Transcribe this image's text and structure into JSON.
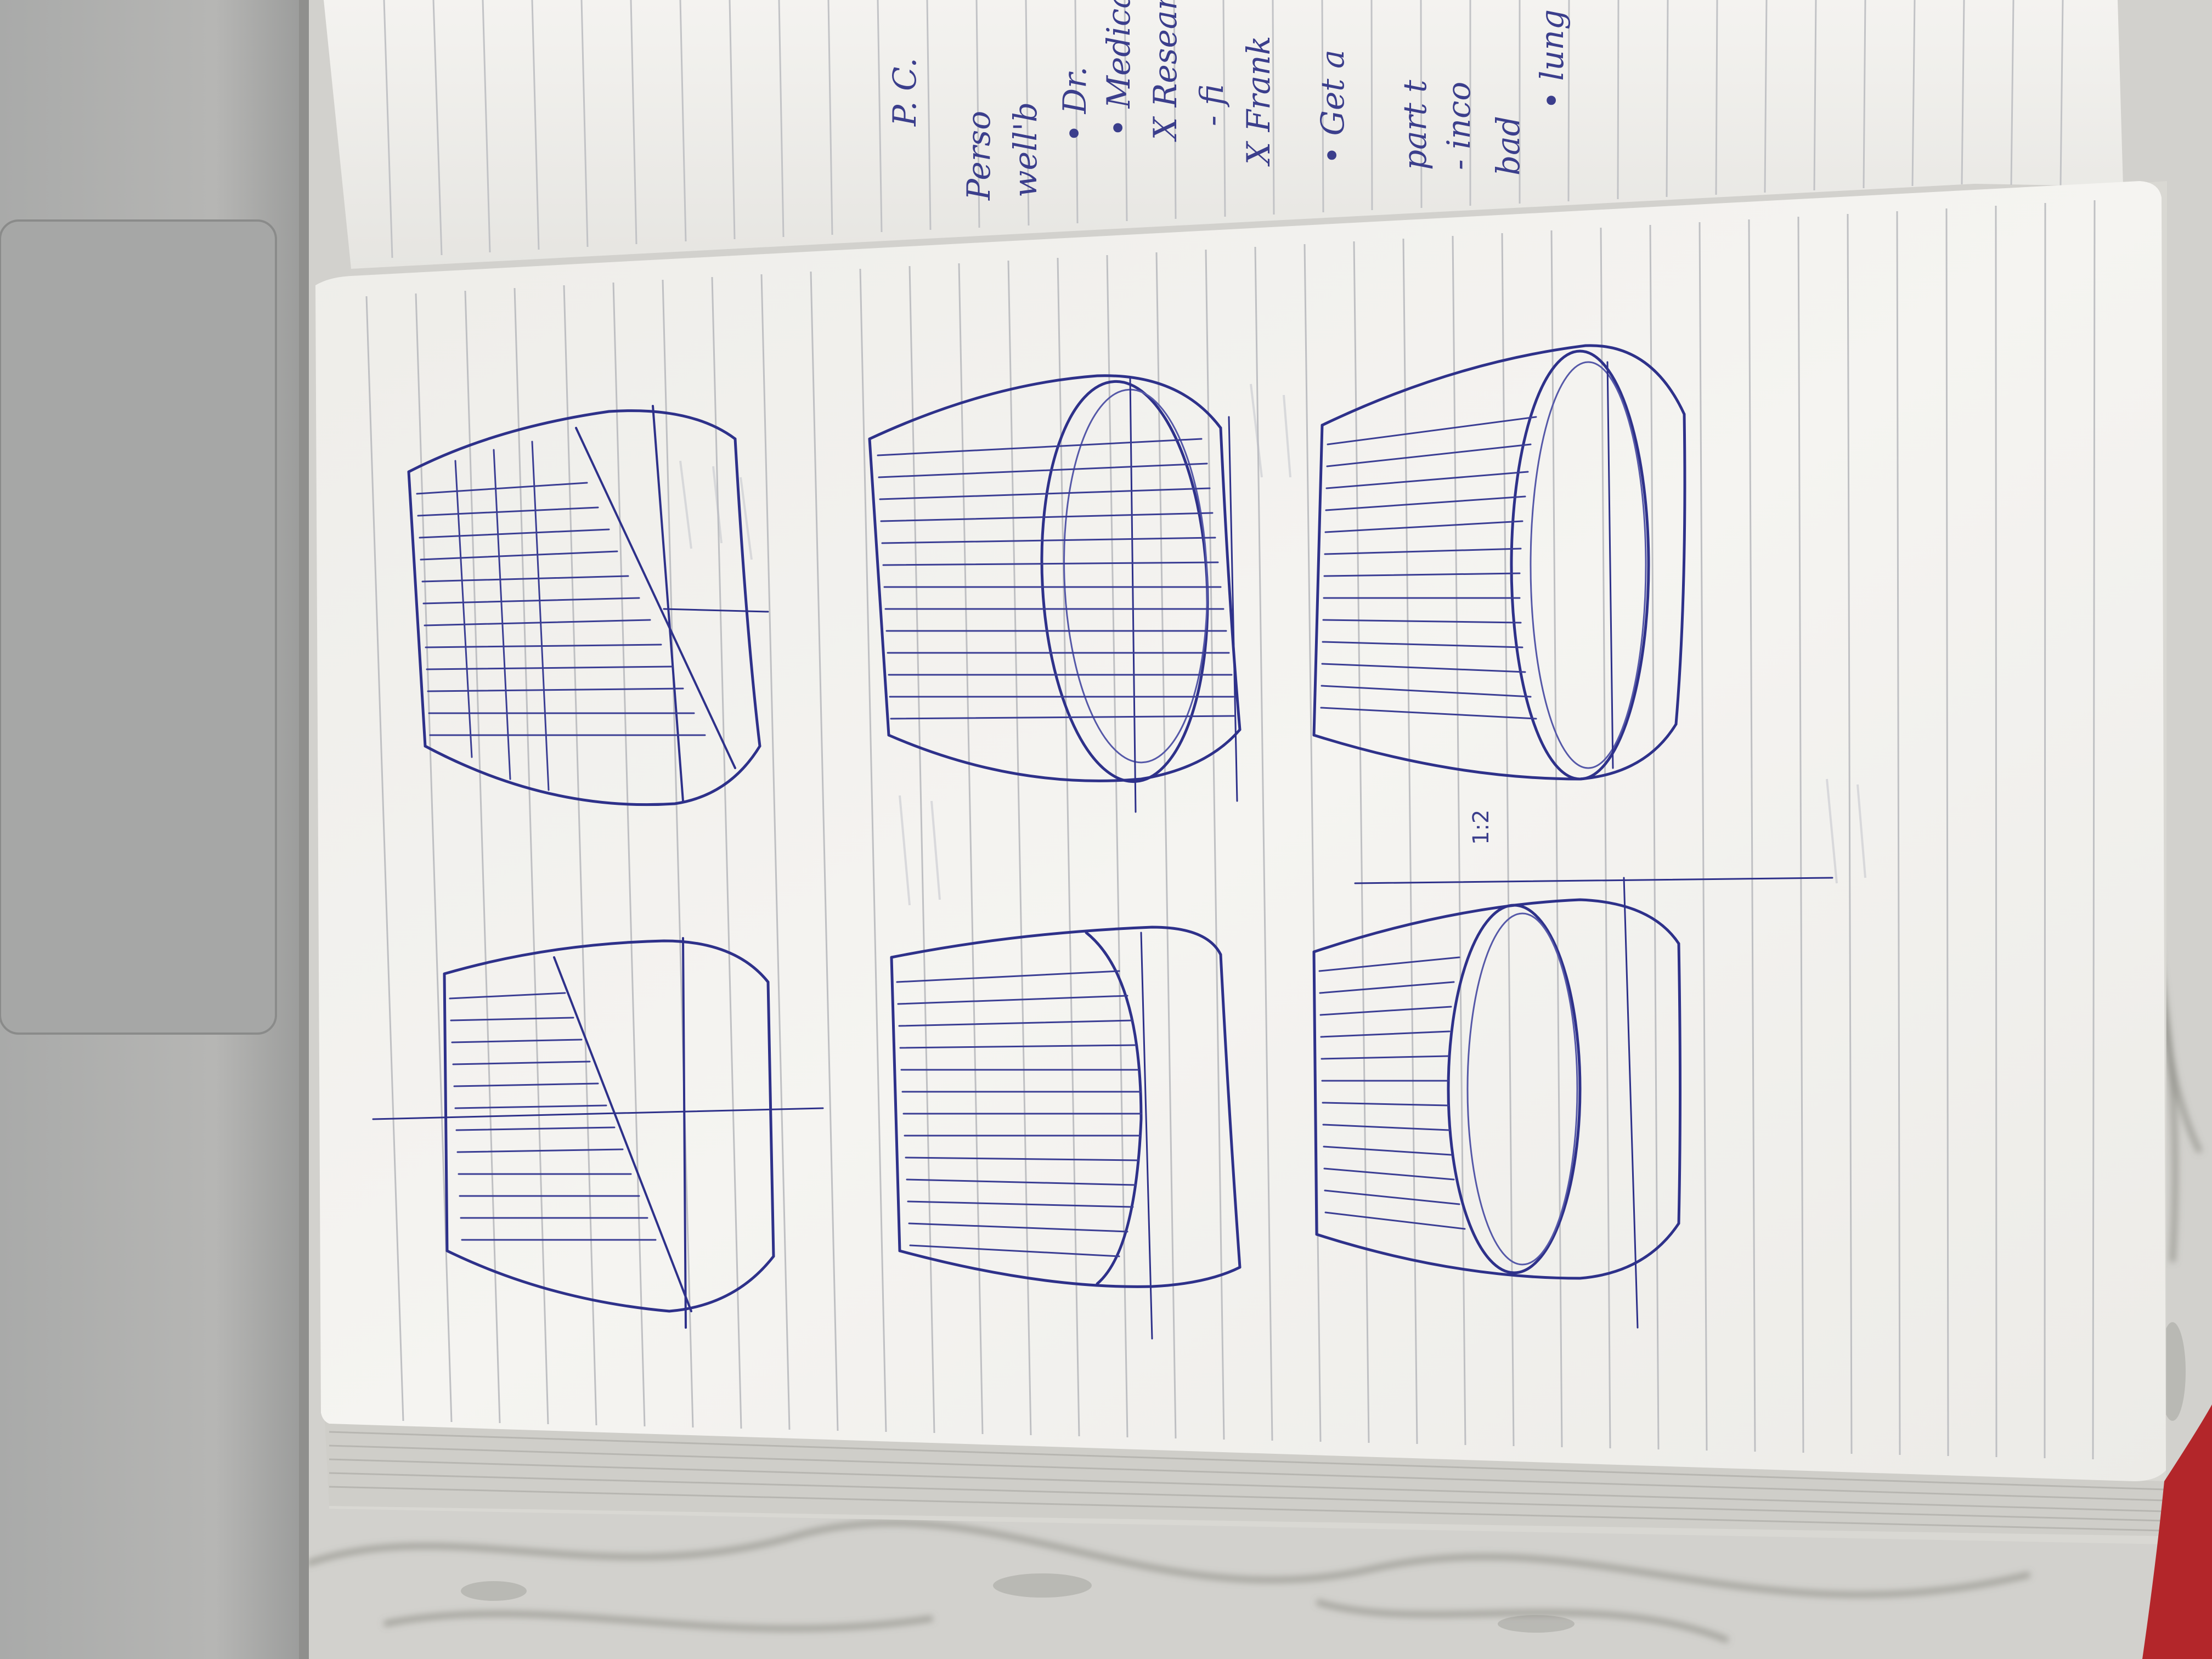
{
  "scene": {
    "background_surface": "marble countertop",
    "laptop": "laptop palm rest with trackpad",
    "notebook": "spiral-free ruled notebook, rotated 90 degrees"
  },
  "colors": {
    "marble": "#d4d3cf",
    "marble_vein": "#6f6e6a",
    "laptop_body": "#b2b2b0",
    "laptop_edge": "#8f8f8d",
    "trackpad": "#a4a5a4",
    "paper": "#f3f2ef",
    "paper_shadow": "#c9c8c3",
    "ruling": "#bfc0c3",
    "ink": "#2e318a",
    "ink_light": "#6a6db3",
    "red_object": "#b3262a"
  },
  "sketches": [
    {
      "name": "cube-study-1",
      "type": "box with diagonal shading"
    },
    {
      "name": "cube-study-2",
      "type": "box with inscribed ellipse"
    },
    {
      "name": "cube-study-3",
      "type": "box with inscribed ellipse"
    },
    {
      "name": "cube-study-4",
      "type": "box with diagonal shading"
    },
    {
      "name": "cube-study-5",
      "type": "box with curved face"
    },
    {
      "name": "cube-study-6",
      "type": "box with inscribed ellipse"
    }
  ],
  "notes": {
    "lines": [
      "P. C.",
      "Perso",
      "well'b",
      "• Dr.",
      "• Medica",
      "X Resear",
      "- fi",
      "X Frank",
      "• Get a",
      "part t",
      "- inco",
      "bad",
      "• lung"
    ],
    "page_marks": [
      "1:2"
    ]
  }
}
